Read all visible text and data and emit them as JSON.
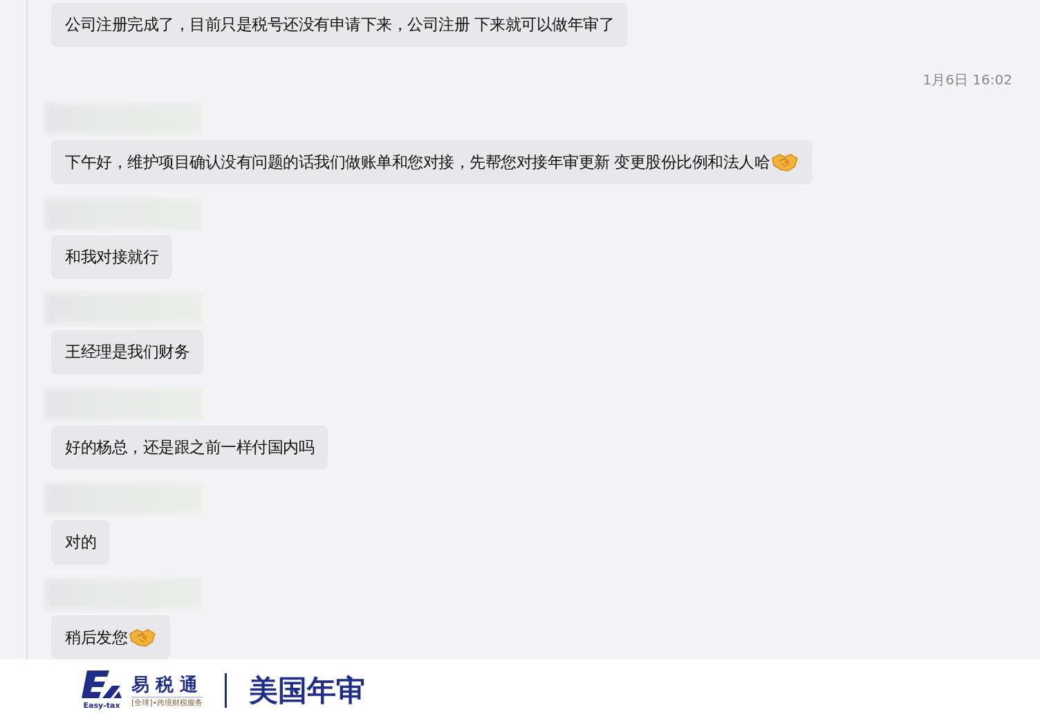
{
  "messages": [
    {
      "kind": "message",
      "sender_hidden": false,
      "text": "公司注册完成了，目前只是税号还没有申请下来，公司注册 下来就可以做年审了",
      "handshake": false
    },
    {
      "kind": "timestamp",
      "text": "1月6日 16:02"
    },
    {
      "kind": "message",
      "sender_hidden": true,
      "text": "下午好，维护项目确认没有问题的话我们做账单和您对接，先帮您对接年审更新 变更股份比例和法人哈",
      "handshake": true
    },
    {
      "kind": "message",
      "sender_hidden": true,
      "text": "和我对接就行",
      "handshake": false
    },
    {
      "kind": "message",
      "sender_hidden": true,
      "text": "王经理是我们财务",
      "handshake": false
    },
    {
      "kind": "message",
      "sender_hidden": true,
      "text": "好的杨总，还是跟之前一样付国内吗",
      "handshake": false
    },
    {
      "kind": "message",
      "sender_hidden": true,
      "text": "对的",
      "handshake": false
    },
    {
      "kind": "message",
      "sender_hidden": true,
      "text": "稍后发您",
      "handshake": true
    }
  ],
  "footer": {
    "logo_mark": "Easy-tax",
    "logo_name": "易 税 通",
    "logo_tagline": "[全球]•跨境财税服务",
    "title": "美国年审"
  }
}
